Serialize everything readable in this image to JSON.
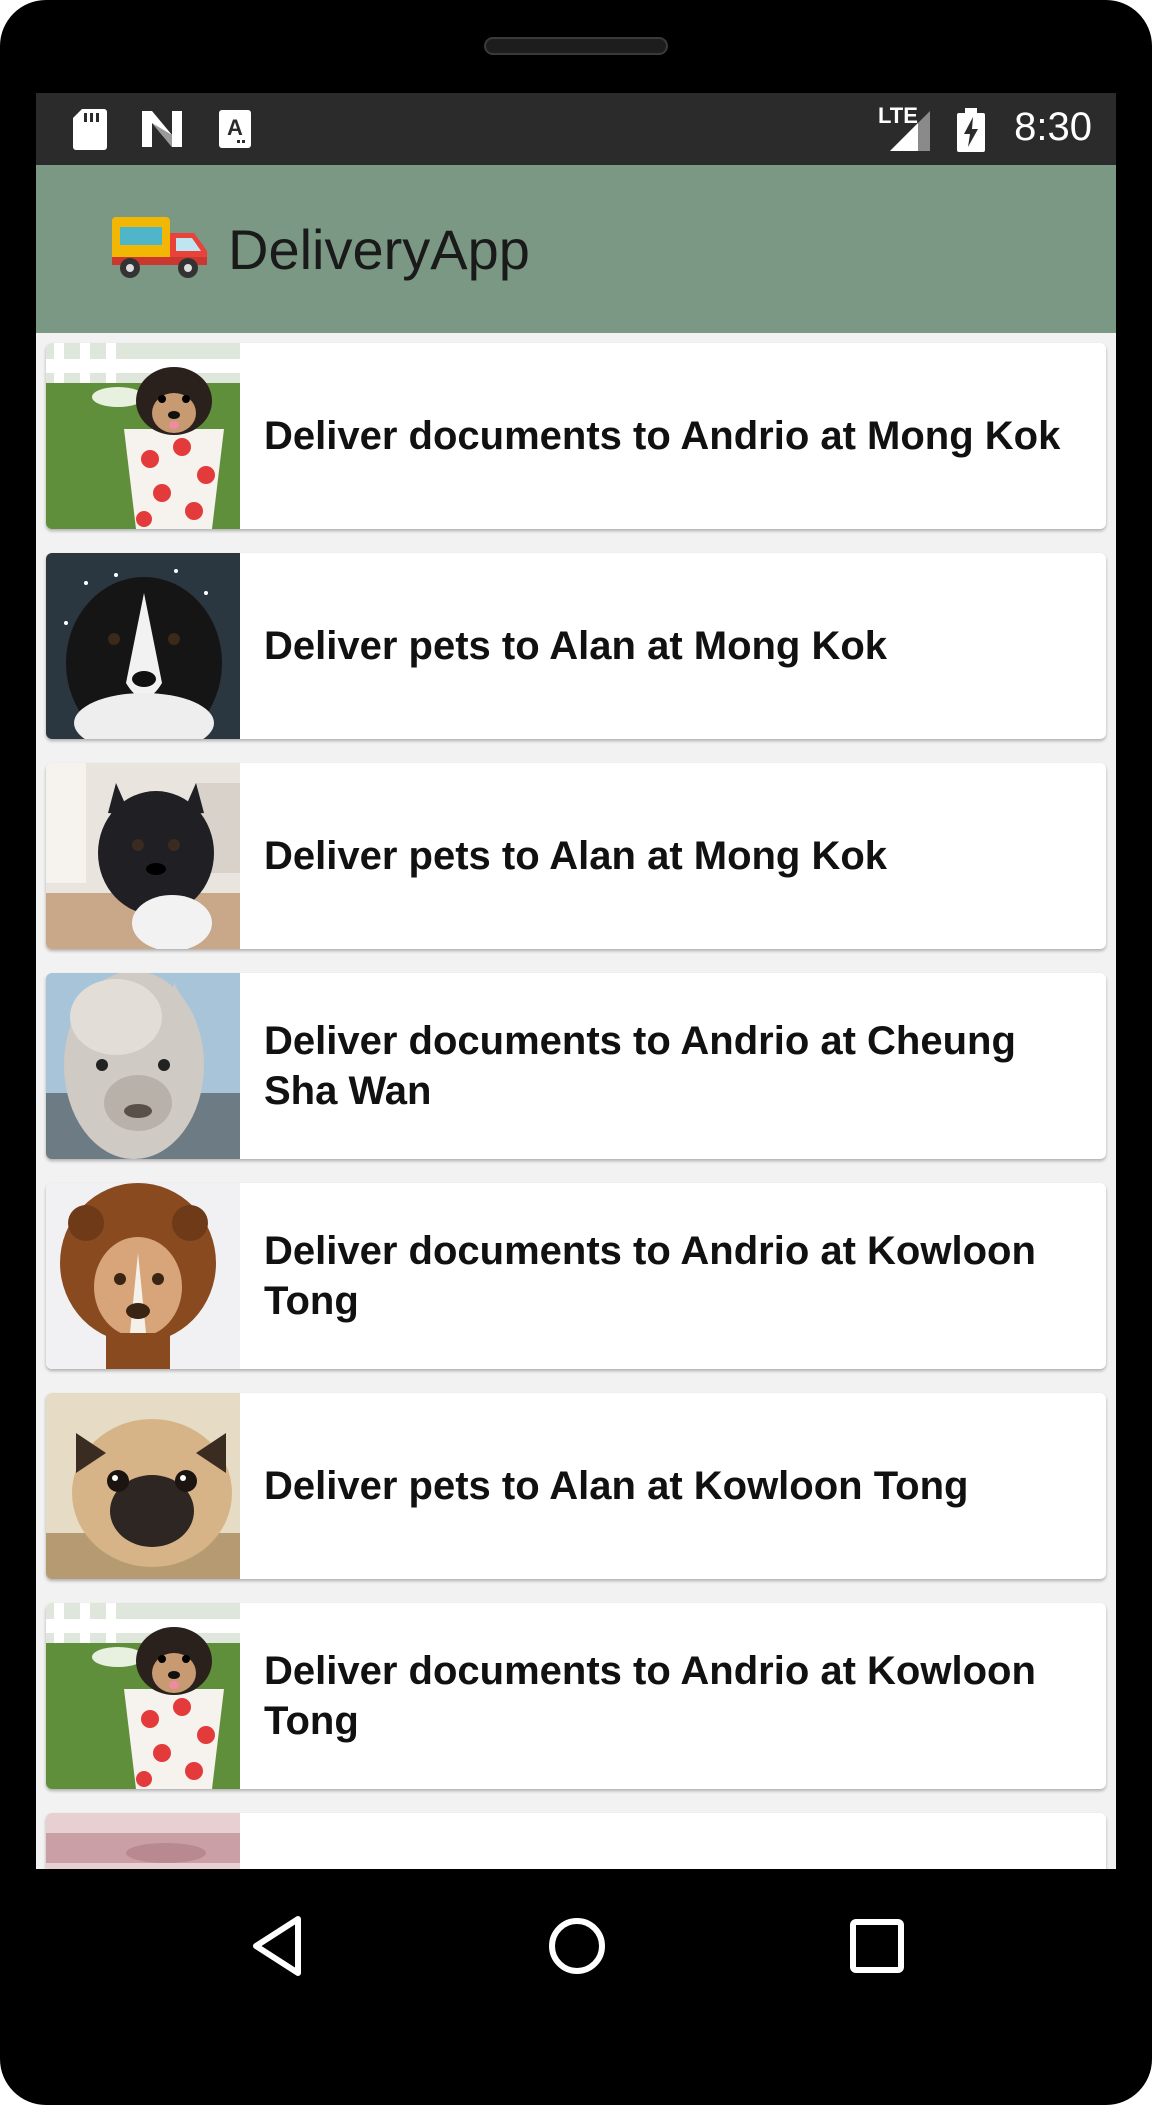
{
  "status_bar": {
    "time": "8:30",
    "network_label": "LTE",
    "icons": [
      "sd-card-icon",
      "n-logo-icon",
      "keyboard-a-icon",
      "lte-signal-icon",
      "battery-charging-icon"
    ]
  },
  "app_bar": {
    "title": "DeliveryApp",
    "logo_icon": "delivery-truck-icon"
  },
  "deliveries": [
    {
      "text": "Deliver documents to Andrio at Mong Kok",
      "image": "puppy-in-cup"
    },
    {
      "text": "Deliver pets to Alan at Mong Kok",
      "image": "border-collie-in-snow"
    },
    {
      "text": "Deliver pets to Alan at Mong Kok",
      "image": "french-bulldog"
    },
    {
      "text": "Deliver documents to Andrio at Cheung Sha Wan",
      "image": "alpaca"
    },
    {
      "text": "Deliver documents to Andrio at Kowloon Tong",
      "image": "dog-in-lion-hood"
    },
    {
      "text": "Deliver pets to Alan at Kowloon Tong",
      "image": "pug"
    },
    {
      "text": "Deliver documents to Andrio at Kowloon Tong",
      "image": "puppy-in-cup"
    }
  ],
  "nav_bar": {
    "icons": [
      "back-icon",
      "home-icon",
      "recents-icon"
    ]
  },
  "colors": {
    "app_bar": "#7a9884",
    "status_bar": "#2b2b2b",
    "list_background": "#f2f2f2"
  }
}
